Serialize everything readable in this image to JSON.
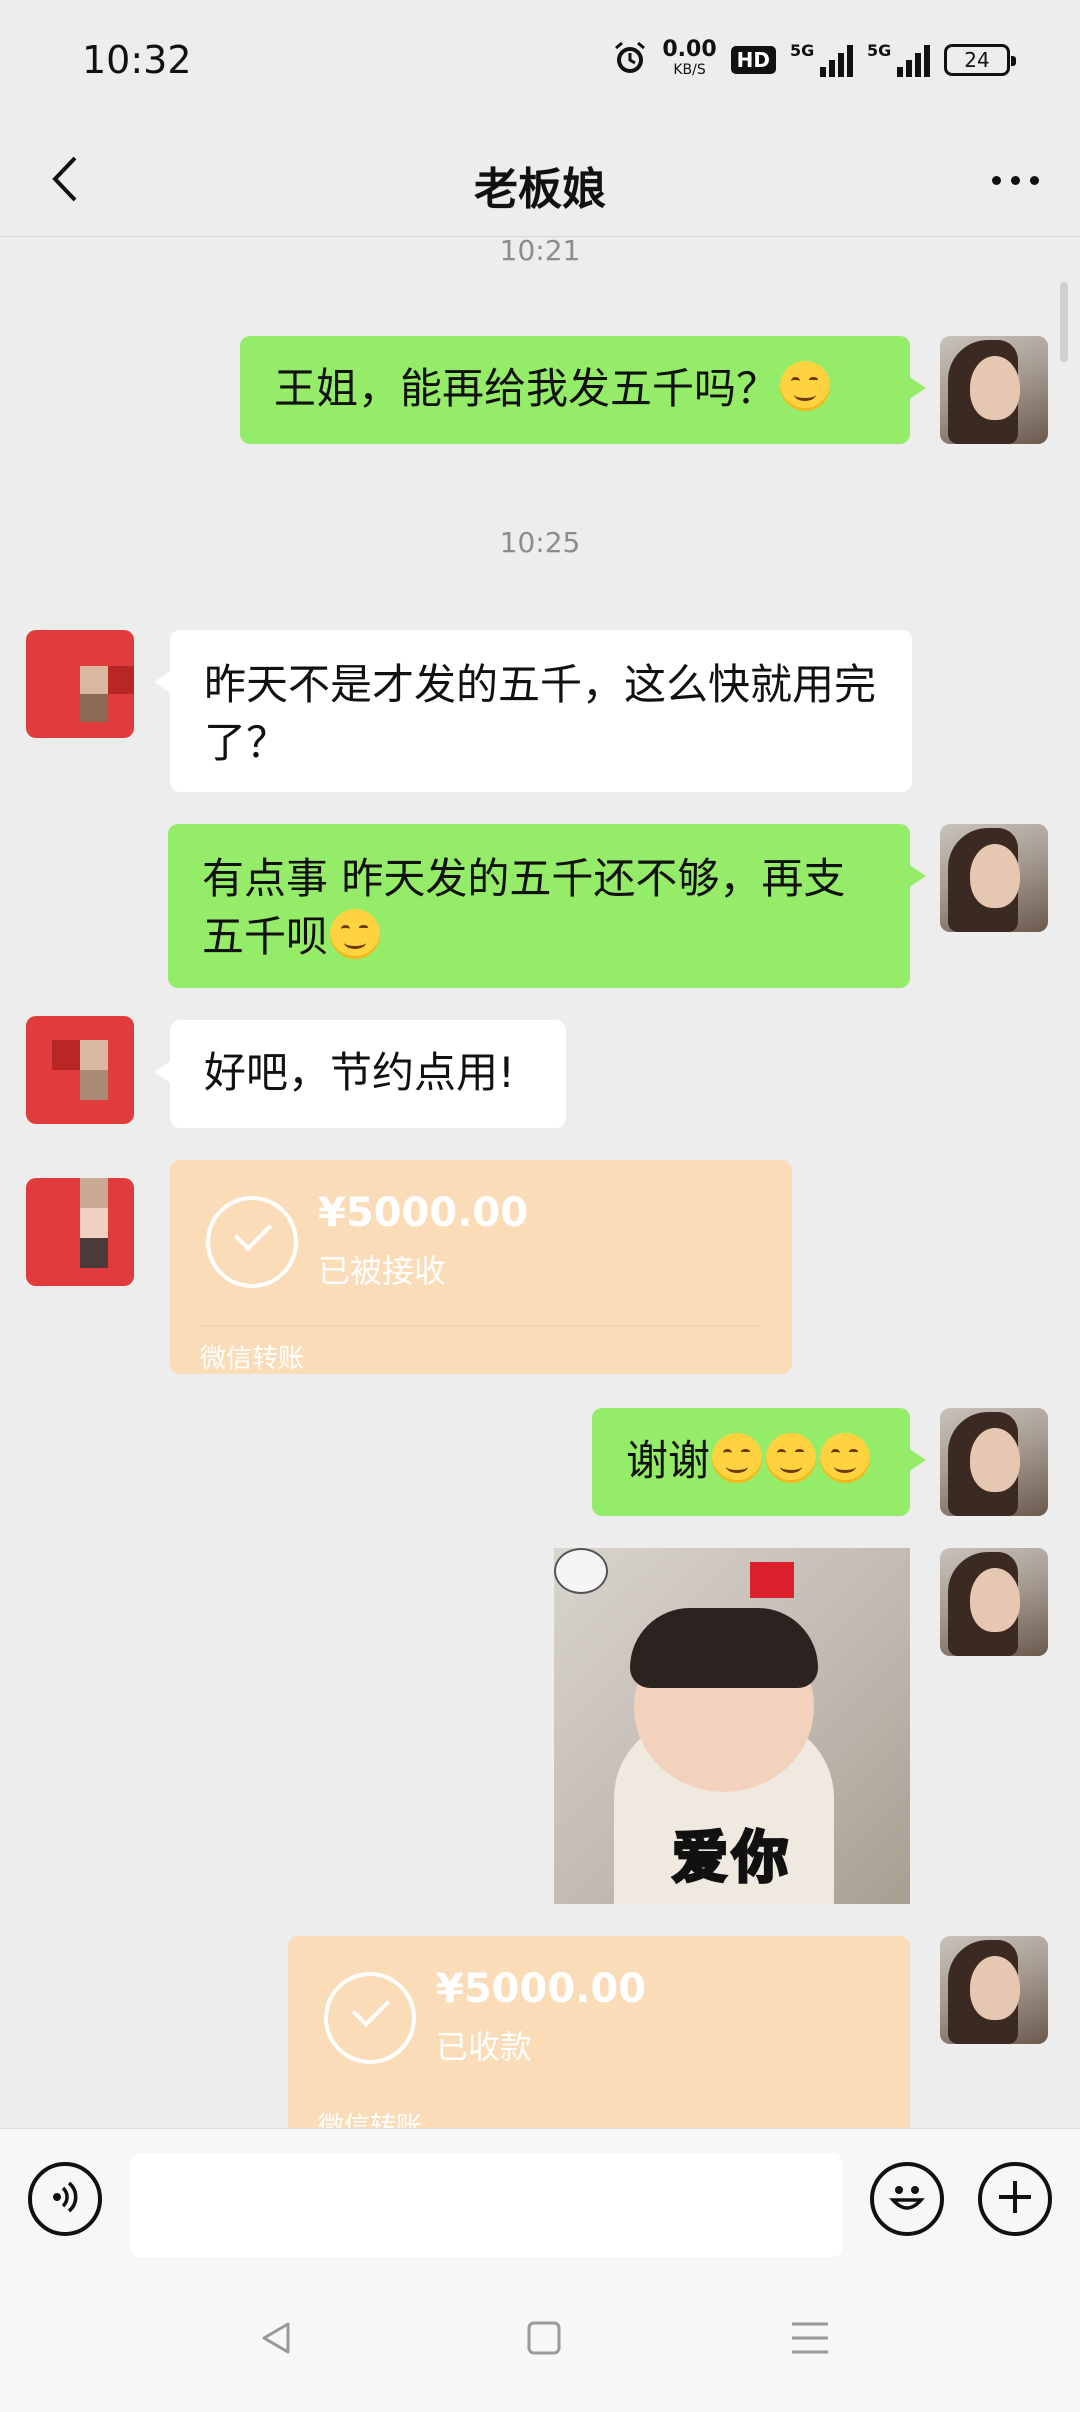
{
  "status_bar": {
    "time": "10:32",
    "speed_value": "0.00",
    "speed_unit": "KB/S",
    "hd_label": "HD",
    "signal1_label": "5G",
    "signal2_label": "5G",
    "battery": "24",
    "icons": [
      "alarm-icon",
      "hd-icon",
      "signal-icon",
      "signal-icon",
      "battery-icon"
    ]
  },
  "header": {
    "title": "老板娘",
    "back_icon": "chevron-left-icon",
    "more_icon": "more-dots-icon"
  },
  "messages": [
    {
      "type": "timestamp",
      "text": "10:21"
    },
    {
      "type": "text",
      "sender": "me",
      "text": "王姐，能再给我发五千吗？",
      "emoji_count": 1
    },
    {
      "type": "timestamp",
      "text": "10:25"
    },
    {
      "type": "text",
      "sender": "other",
      "text": "昨天不是才发的五千，这么快就用完了？",
      "emoji_count": 0
    },
    {
      "type": "text",
      "sender": "me",
      "text": "有点事 昨天发的五千还不够，再支五千呗",
      "emoji_count": 1
    },
    {
      "type": "text",
      "sender": "other",
      "text": "好吧，节约点用!",
      "emoji_count": 0
    },
    {
      "type": "transfer",
      "sender": "other",
      "amount": "¥5000.00",
      "status": "已被接收",
      "footer": "微信转账"
    },
    {
      "type": "text",
      "sender": "me",
      "text": "谢谢",
      "emoji_count": 3
    },
    {
      "type": "sticker",
      "sender": "me",
      "caption": "爱你"
    },
    {
      "type": "transfer",
      "sender": "me",
      "amount": "¥5000.00",
      "status": "已收款",
      "footer": "微信转账"
    }
  ],
  "input_bar": {
    "value": "",
    "placeholder": "",
    "voice_icon": "voice-icon",
    "emoji_icon": "emoji-icon",
    "plus_icon": "plus-icon"
  },
  "nav_bar": {
    "icons": [
      "back-triangle-icon",
      "home-square-icon",
      "menu-lines-icon"
    ]
  },
  "colors": {
    "background": "#ededed",
    "my_bubble": "#95ec69",
    "other_bubble": "#ffffff",
    "transfer_card": "#fbdcb8",
    "timestamp": "#8c8c8c"
  }
}
